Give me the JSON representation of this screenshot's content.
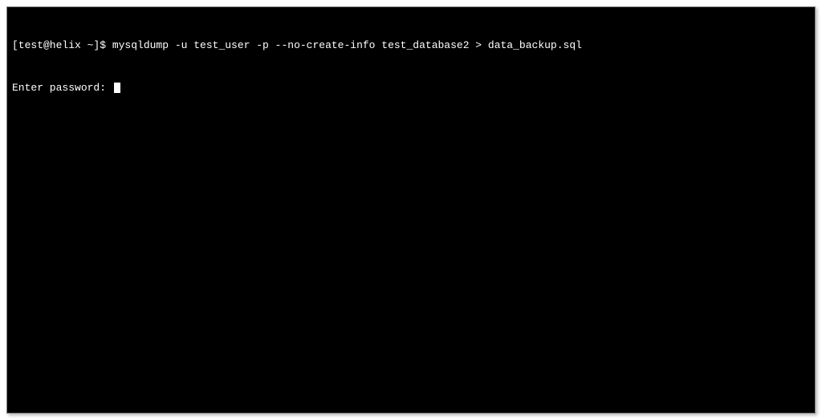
{
  "terminal": {
    "prompt": "[test@helix ~]$ ",
    "command": "mysqldump -u test_user -p --no-create-info test_database2 > data_backup.sql",
    "password_prompt": "Enter password: "
  }
}
